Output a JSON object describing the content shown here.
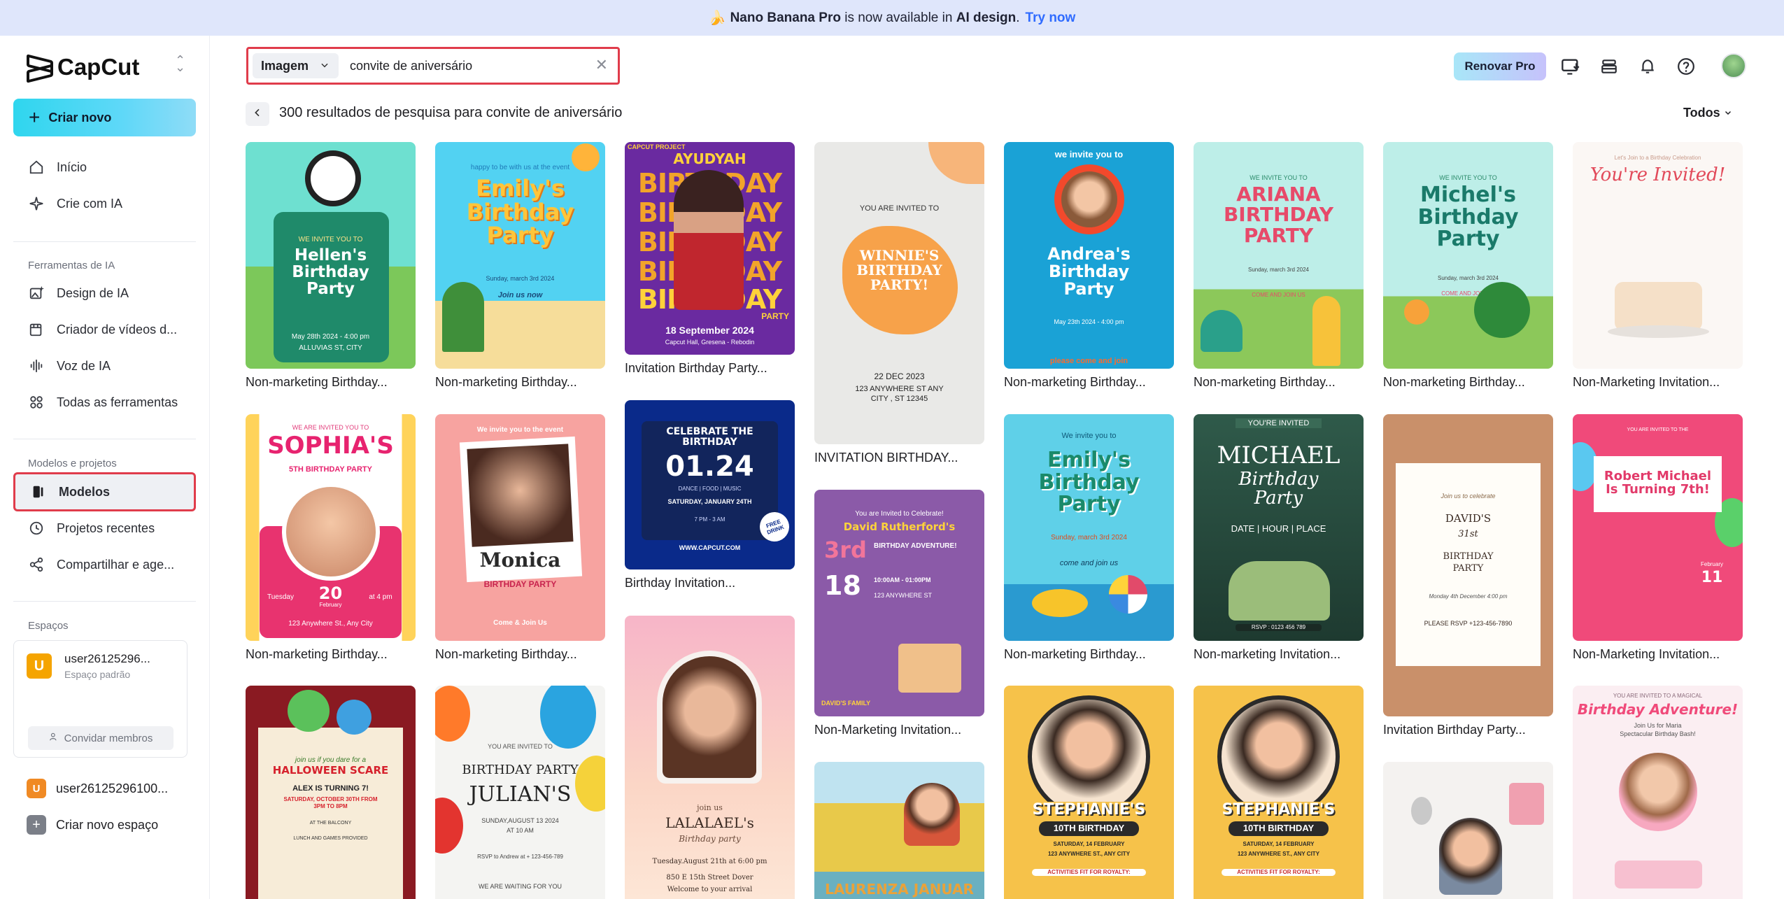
{
  "banner": {
    "emoji": "🍌",
    "product": "Nano Banana Pro",
    "text_mid": " is now available in ",
    "feature": "AI design",
    "dot": ".",
    "link": "Try now"
  },
  "sidebar": {
    "logo": "CapCut",
    "create_new": "Criar novo",
    "nav_main": [
      {
        "label": "Início",
        "icon": "home-icon"
      },
      {
        "label": "Crie com IA",
        "icon": "sparkle-icon"
      }
    ],
    "ai_tools_label": "Ferramentas de IA",
    "ai_tools": [
      {
        "label": "Design de IA",
        "icon": "image-sparkle-icon"
      },
      {
        "label": "Criador de vídeos d...",
        "icon": "video-sparkle-icon"
      },
      {
        "label": "Voz de IA",
        "icon": "waveform-icon"
      },
      {
        "label": "Todas as ferramentas",
        "icon": "grid-icon"
      }
    ],
    "projects_label": "Modelos e projetos",
    "projects": [
      {
        "label": "Modelos",
        "icon": "templates-icon"
      },
      {
        "label": "Projetos recentes",
        "icon": "clock-icon"
      },
      {
        "label": "Compartilhar e age...",
        "icon": "share-icon"
      }
    ],
    "spaces_label": "Espaços",
    "space": {
      "initial": "U",
      "name": "user26125296...",
      "sub": "Espaço padrão",
      "invite": "Convidar membros"
    },
    "space2": {
      "initial": "U",
      "name": "user26125296100..."
    },
    "new_space": "Criar novo espaço"
  },
  "topbar": {
    "search_type": "Imagem",
    "search_value": "convite de aniversário",
    "renew": "Renovar Pro"
  },
  "results": {
    "text": "300 resultados de pesquisa para convite de aniversário",
    "filter": "Todos"
  },
  "cards": {
    "c1": {
      "title": "Non-marketing Birthday...",
      "l1": "WE INVITE YOU TO",
      "l2": "Hellen's Birthday Party",
      "l3": "May 28th 2024 - 4:00 pm",
      "l4": "ALLUVIAS ST, CITY"
    },
    "c2": {
      "title": "Non-marketing Birthday...",
      "l1": "happy to be with us at the event",
      "l2": "Emily's Birthday Party",
      "l3": "Sunday, march 3rd 2024",
      "l4": "Join us now"
    },
    "c3": {
      "title": "Invitation Birthday Party...",
      "l0": "CAPCUT PROJECT",
      "l1": "AYUDYAH",
      "l2": "BIRTHDAY",
      "l3": "PARTY",
      "l4": "18 September 2024",
      "l5": "Capcut Hall, Gresena - Rebodin"
    },
    "c4": {
      "title": "INVITATION BIRTHDAY...",
      "l1": "YOU ARE INVITED TO",
      "l2": "WINNIE'S BIRTHDAY PARTY!",
      "l3": "22 DEC 2023",
      "l4": "123 ANYWHERE ST ANY CITY , ST 12345"
    },
    "c5": {
      "title": "Non-marketing Birthday...",
      "l1": "we invite you to",
      "l2": "Andrea's Birthday Party",
      "l3": "May 23th 2024 - 4:00 pm",
      "l4": "please come and join"
    },
    "c6": {
      "title": "Non-marketing Birthday...",
      "l1": "WE INVITE YOU TO",
      "l2": "ARIANA BIRTHDAY PARTY",
      "l3": "Sunday, march 3rd 2024",
      "l4": "COME AND JOIN US"
    },
    "c7": {
      "title": "Non-marketing Birthday...",
      "l1": "WE INVITE YOU TO",
      "l2": "Michel's Birthday Party",
      "l3": "Sunday, march 3rd 2024",
      "l4": "COME AND JOIN US"
    },
    "c8": {
      "title": "Non-Marketing Invitation...",
      "l1": "Let's Join to a Birthday Celebration",
      "l2": "You're Invited!"
    },
    "c9": {
      "title": "Non-marketing Birthday...",
      "l1": "WE ARE INVITED YOU TO",
      "l2": "SOPHIA'S",
      "l3": "5TH BIRTHDAY PARTY",
      "l4": "Tuesday",
      "l5": "20",
      "l6": "February",
      "l7": "at 4 pm",
      "l8": "123 Anywhere St., Any City"
    },
    "c10": {
      "title": "Non-marketing Birthday...",
      "l1": "We invite you to the event",
      "l2": "Monica",
      "l3": "BIRTHDAY PARTY",
      "l4": "Come & Join Us"
    },
    "c11": {
      "title": "Birthday Invitation...",
      "l1": "CELEBRATE THE BIRTHDAY",
      "l2": "01.24",
      "l3": "DANCE | FOOD | MUSIC",
      "l4": "SATURDAY, JANUARY 24TH",
      "l5": "7 PM - 3 AM",
      "l6": "WWW.CAPCUT.COM",
      "l7": "FREE DRINK"
    },
    "c12": {
      "title": "Non-Marketing Invitation...",
      "l1": "You are Invited to Celebrate!",
      "l2": "David Rutherford's",
      "l3": "3rd",
      "l4": "BIRTHDAY ADVENTURE!",
      "l5": "18",
      "l6": "10:00AM - 01:00PM",
      "l7": "123 ANYWHERE ST",
      "l8": "DAVID'S FAMILY"
    },
    "c13": {
      "title": "Non-marketing Birthday...",
      "l1": "We invite you to",
      "l2": "Emily's Birthday Party",
      "l3": "Sunday, march 3rd 2024",
      "l4": "come and join us"
    },
    "c14": {
      "title": "Non-marketing Invitation...",
      "l1": "YOU'RE INVITED",
      "l2": "MICHAEL",
      "l3": "Birthday Party",
      "l4": "DATE  |  HOUR  |  PLACE",
      "l5": "RSVP : 0123 456 789"
    },
    "c15": {
      "title": "Invitation Birthday Party...",
      "l1": "Join us to celebrate",
      "l2": "DAVID'S",
      "l3": "31st",
      "l4": "BIRTHDAY PARTY",
      "l5": "Monday 4th December 4:00 pm",
      "l6": "PLEASE RSVP +123-456-7890"
    },
    "c16": {
      "title": "Non-Marketing Invitation...",
      "l1": "YOU ARE INVITED TO THE",
      "l2": "Robert Michael Is Turning 7th!",
      "l3": "February",
      "l4": "11"
    },
    "c17": {
      "l1": "join us if you dare for a",
      "l2": "HALLOWEEN SCARE",
      "l3": "ALEX IS TURNING 7!",
      "l4": "SATURDAY, OCTOBER 30TH FROM 3PM TO 8PM",
      "l5": "AT THE BALCONY",
      "l6": "LUNCH AND GAMES PROVIDED"
    },
    "c18": {
      "l1": "YOU ARE INVITED TO",
      "l2": "BIRTHDAY PARTY",
      "l3": "JULIAN'S",
      "l4": "SUNDAY,AUGUST 13 2024",
      "l5": "AT 10 AM",
      "l6": "RSVP to Andrew at + 123-456-789",
      "l7": "WE ARE WAITING FOR YOU"
    },
    "c19": {
      "l1": "join us",
      "l2": "LALALAEL's",
      "l3": "Birthday party",
      "l4": "Tuesday.August 21th at 6:00 pm",
      "l5": "850 E 15th Street Dover",
      "l6": "Welcome to your arrival"
    },
    "c20": {
      "l1": "LAURENZA JANUAR"
    },
    "c21": {
      "l1": "STEPHANIE'S",
      "l2": "10TH BIRTHDAY",
      "l3": "SATURDAY, 14 FEBRUARY",
      "l4": "123 ANYWHERE ST., ANY CITY",
      "l5": "ACTIVITIES FIT FOR ROYALTY:"
    },
    "c22": {
      "l1": "STEPHANIE'S",
      "l2": "10TH BIRTHDAY",
      "l3": "SATURDAY, 14 FEBRUARY",
      "l4": "123 ANYWHERE ST., ANY CITY",
      "l5": "ACTIVITIES FIT FOR ROYALTY:"
    },
    "c24": {
      "l1": "YOU ARE INVITED TO A MAGICAL",
      "l2": "Birthday Adventure!",
      "l3": "Join Us for Maria",
      "l4": "Spectacular Birthday Bash!"
    }
  }
}
